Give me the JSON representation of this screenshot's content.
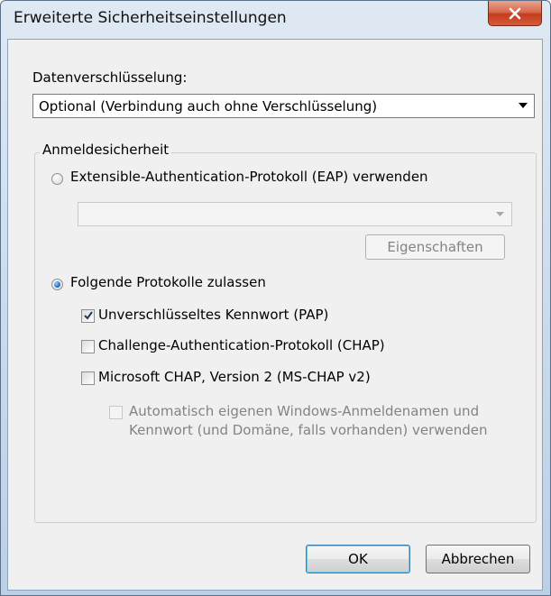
{
  "window": {
    "title": "Erweiterte Sicherheitseinstellungen",
    "close_label": "X"
  },
  "encryption": {
    "label": "Datenverschlüsselung:",
    "selected": "Optional (Verbindung auch ohne Verschlüsselung)"
  },
  "login_security": {
    "legend": "Anmeldesicherheit",
    "eap_option": {
      "label": "Extensible-Authentication-Protokoll (EAP) verwenden",
      "selected": false
    },
    "eap_dropdown_value": "",
    "properties_button": "Eigenschaften",
    "protocols_option": {
      "label": "Folgende Protokolle zulassen",
      "selected": true
    },
    "protocols": [
      {
        "label": "Unverschlüsseltes Kennwort (PAP)",
        "checked": true
      },
      {
        "label": "Challenge-Authentication-Protokoll (CHAP)",
        "checked": false
      },
      {
        "label": "Microsoft CHAP, Version 2 (MS-CHAP v2)",
        "checked": false
      }
    ],
    "auto_windows_login": {
      "line1": "Automatisch eigenen Windows-Anmeldenamen und",
      "line2": "Kennwort (und Domäne, falls vorhanden) verwenden",
      "checked": false,
      "disabled": true
    }
  },
  "buttons": {
    "ok": "OK",
    "cancel": "Abbrechen"
  },
  "colors": {
    "title_gradient_top": "#dfe9f3",
    "close_button": "#c23d1e",
    "dialog_background": "#f0f0f0",
    "checkbox_check": "#1e395b",
    "disabled_text": "#838383"
  }
}
